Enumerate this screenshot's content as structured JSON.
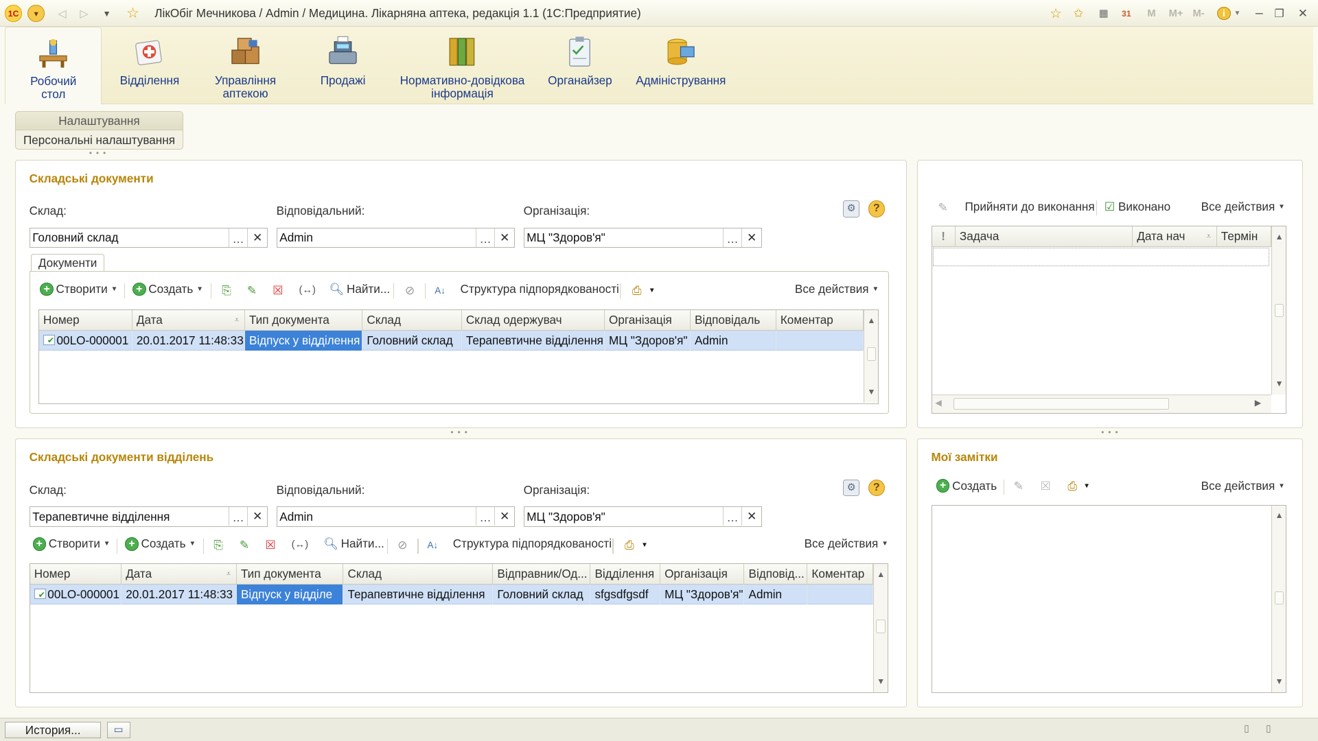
{
  "window": {
    "title": "ЛікОбіг Мечникова / Admin / Медицина. Лікарняна аптека, редакція 1.1  (1С:Предприятие)"
  },
  "titlebar_right": [
    "M",
    "M+",
    "M-"
  ],
  "sections": [
    {
      "label_line1": "Робочий",
      "label_line2": "стол",
      "icon": "desk-icon"
    },
    {
      "label_line1": "Відділення",
      "label_line2": "",
      "icon": "first-aid-icon"
    },
    {
      "label_line1": "Управління",
      "label_line2": "аптекою",
      "icon": "boxes-icon"
    },
    {
      "label_line1": "Продажі",
      "label_line2": "",
      "icon": "cash-register-icon"
    },
    {
      "label_line1": "Нормативно-довідкова",
      "label_line2": "інформація",
      "icon": "binders-icon"
    },
    {
      "label_line1": "Органайзер",
      "label_line2": "",
      "icon": "clipboard-icon"
    },
    {
      "label_line1": "Адміністрування",
      "label_line2": "",
      "icon": "database-icon"
    }
  ],
  "nav": {
    "header": "Налаштування",
    "item": "Персональні налаштування"
  },
  "warehouse_docs": {
    "title": "Складські документи",
    "labels": {
      "warehouse": "Склад:",
      "responsible": "Відповідальний:",
      "organization": "Організація:"
    },
    "values": {
      "warehouse": "Головний склад",
      "responsible": "Admin",
      "organization": "МЦ \"Здоров'я\""
    },
    "tab": "Документи",
    "toolbar": {
      "create_ua": "Створити",
      "create_ru": "Создать",
      "find": "Найти...",
      "structure": "Структура підпорядкованості",
      "all_actions": "Все действия"
    },
    "columns": [
      "Номер",
      "Дата",
      "Тип документа",
      "Склад",
      "Склад одержувач",
      "Організація",
      "Відповідаль",
      "Коментар"
    ],
    "rows": [
      [
        "00LO-000001",
        "20.01.2017 11:48:33",
        "Відпуск у відділення",
        "Головний склад",
        "Терапевтичне відділення",
        "МЦ \"Здоров'я\"",
        "Admin",
        ""
      ]
    ]
  },
  "dept_docs": {
    "title": "Складські документи відділень",
    "labels": {
      "warehouse": "Склад:",
      "responsible": "Відповідальний:",
      "organization": "Організація:"
    },
    "values": {
      "warehouse": "Терапевтичне відділення",
      "responsible": "Admin",
      "organization": "МЦ \"Здоров'я\""
    },
    "toolbar": {
      "create_ua": "Створити",
      "create_ru": "Создать",
      "find": "Найти...",
      "structure": "Структура підпорядкованості",
      "all_actions": "Все действия"
    },
    "columns": [
      "Номер",
      "Дата",
      "Тип документа",
      "Склад",
      "Відправник/Од...",
      "Відділення",
      "Організація",
      "Відповід...",
      "Коментар"
    ],
    "rows": [
      [
        "00LO-000001",
        "20.01.2017 11:48:33",
        "Відпуск у відділе",
        "Терапевтичне відділення",
        "Головний склад",
        "sfgsdfgsdf",
        "МЦ \"Здоров'я\"",
        "Admin",
        ""
      ]
    ]
  },
  "tasks": {
    "toolbar": {
      "accept": "Прийняти до виконання",
      "done": "Виконано",
      "all_actions": "Все действия"
    },
    "columns": [
      "!",
      "Задача",
      "Дата нач",
      "Термін"
    ]
  },
  "notes": {
    "title": "Мої замітки",
    "toolbar": {
      "create": "Создать",
      "all_actions": "Все действия"
    }
  },
  "statusbar": {
    "history": "История..."
  }
}
